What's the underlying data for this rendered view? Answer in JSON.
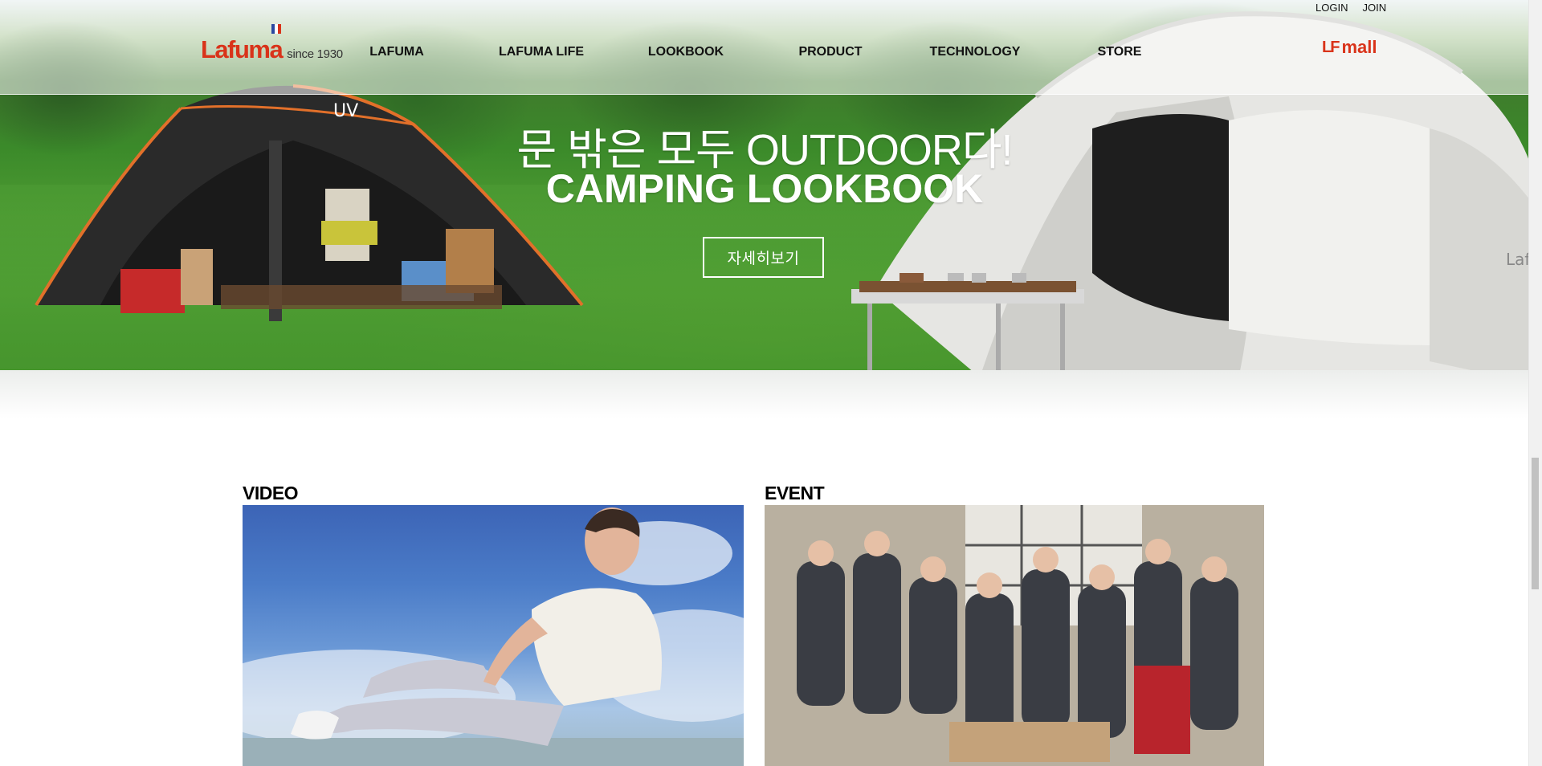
{
  "header": {
    "logo_word": "Lafuma",
    "logo_since": "since 1930",
    "nav": [
      {
        "label": "LAFUMA"
      },
      {
        "label": "LAFUMA LIFE"
      },
      {
        "label": "LOOKBOOK"
      },
      {
        "label": "PRODUCT"
      },
      {
        "label": "TECHNOLOGY"
      },
      {
        "label": "STORE"
      }
    ],
    "login": "LOGIN",
    "join": "JOIN",
    "mall_mark": "LF",
    "mall_label": "mall"
  },
  "hero": {
    "line1": "문 밖은 모두 OUTDOOR다!",
    "line2": "CAMPING LOOKBOOK",
    "button": "자세히보기"
  },
  "sections": {
    "video_title": "VIDEO",
    "event_title": "EVENT"
  },
  "colors": {
    "brand_red": "#d9331a",
    "nav_text": "#111111",
    "hero_text": "#ffffff"
  },
  "icons": [
    "french-flag-icon",
    "lf-mall-logo"
  ]
}
